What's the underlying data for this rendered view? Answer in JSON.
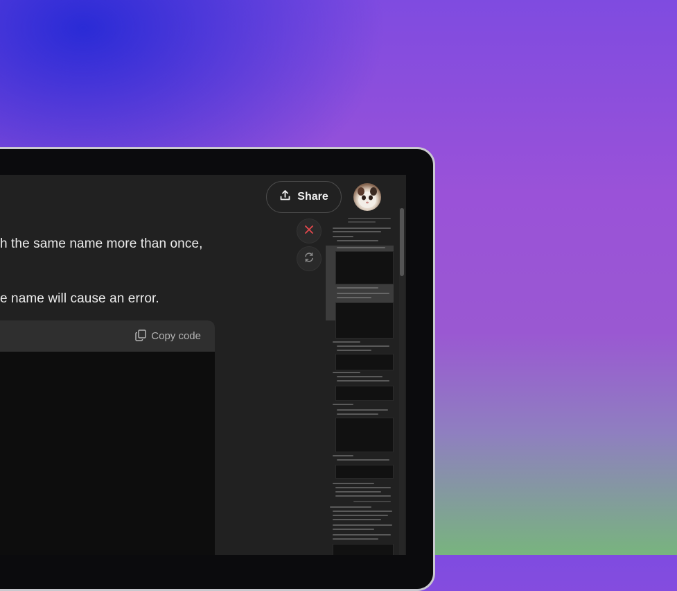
{
  "chat": {
    "line1": "h the same name more than once,",
    "line2": "e name will cause an error."
  },
  "header": {
    "share_label": "Share"
  },
  "code_block": {
    "copy_label": "Copy code"
  },
  "actions": {
    "stop_icon": "close-icon",
    "regenerate_icon": "refresh-icon"
  },
  "colors": {
    "stop_red": "#e5484d",
    "screen_bg": "#212121"
  }
}
